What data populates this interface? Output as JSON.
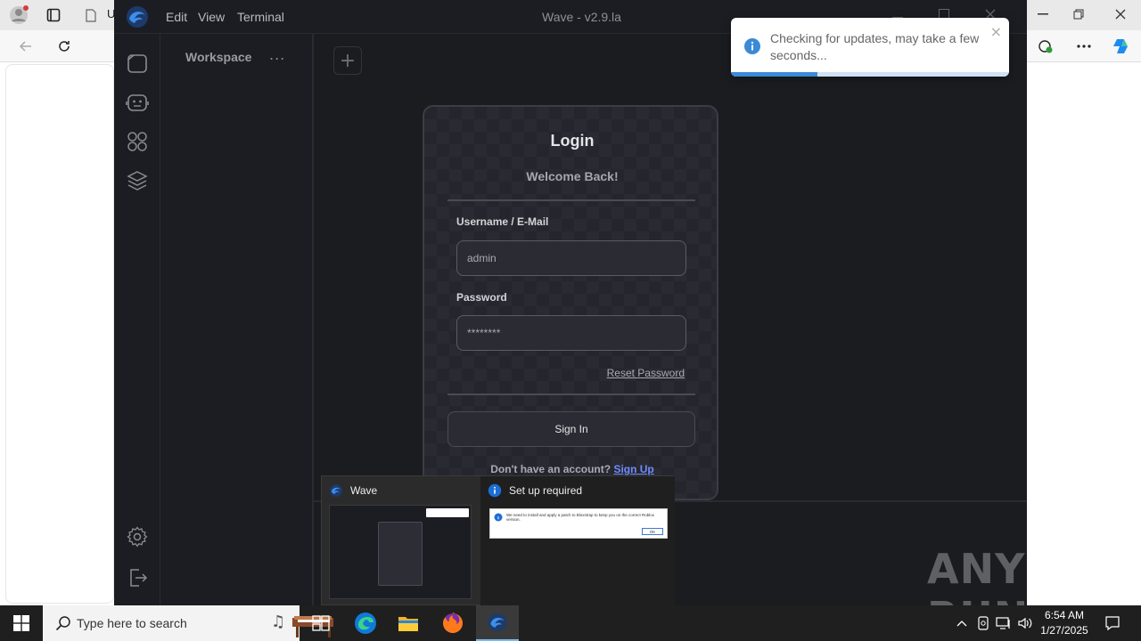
{
  "browser": {
    "tab_label": "U"
  },
  "app": {
    "menu": [
      "Edit",
      "View",
      "Terminal"
    ],
    "title": "Wave - v2.9.la",
    "workspace_title": "Workspace",
    "workspace_more": "...",
    "new_tab_symbol": "+"
  },
  "login": {
    "title": "Login",
    "subtitle": "Welcome Back!",
    "username_label": "Username / E-Mail",
    "username_value": "admin",
    "password_label": "Password",
    "password_value": "********",
    "reset_label": "Reset Password",
    "signin_label": "Sign In",
    "no_account_text": "Don't have an account?",
    "signup_label": "Sign Up"
  },
  "toast": {
    "message": "Checking for updates, may take a few seconds...",
    "close_symbol": "×",
    "progress": 0.31,
    "accent": "#3a8ad6"
  },
  "thumbnails": {
    "wave_label": "Wave",
    "setup_label": "Set up required",
    "setup_message": "We need to install and apply a patch to Bloxstrap to keep you on the correct Roblox version.",
    "setup_ok": "OK"
  },
  "watermark": "ANY RUN",
  "taskbar": {
    "search_placeholder": "Type here to search",
    "time": "6:54 AM",
    "date": "1/27/2025"
  },
  "colors": {
    "app_bg": "#1c1d22",
    "card_bg": "#25262d",
    "link_blue": "#6f8cff",
    "taskbar_bg": "#1f1f1f"
  }
}
